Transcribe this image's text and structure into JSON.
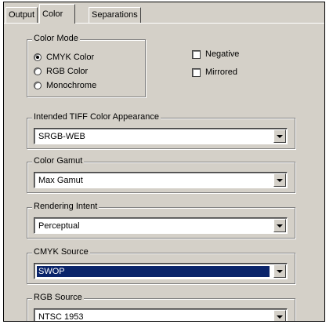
{
  "tabs": [
    {
      "label": "Output"
    },
    {
      "label": "Color"
    },
    {
      "label": "Separations"
    }
  ],
  "color_mode": {
    "legend": "Color Mode",
    "options": [
      {
        "label": "CMYK Color",
        "selected": true
      },
      {
        "label": "RGB Color",
        "selected": false
      },
      {
        "label": "Monochrome",
        "selected": false
      }
    ]
  },
  "checkboxes": {
    "negative": {
      "label": "Negative",
      "checked": false
    },
    "mirrored": {
      "label": "Mirrored",
      "checked": false
    }
  },
  "dropdowns": [
    {
      "legend": "Intended TIFF Color Appearance",
      "value": "SRGB-WEB"
    },
    {
      "legend": "Color Gamut",
      "value": "Max Gamut"
    },
    {
      "legend": "Rendering Intent",
      "value": "Perceptual"
    },
    {
      "legend": "CMYK Source",
      "value": "SWOP"
    },
    {
      "legend": "RGB Source",
      "value": "NTSC 1953"
    }
  ],
  "colors": {
    "face": "#d4d0c8",
    "selection": "#0a246a"
  }
}
